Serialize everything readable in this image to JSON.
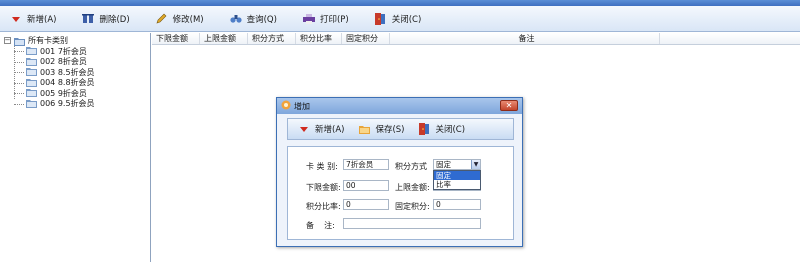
{
  "toolbar": {
    "add": "新增(A)",
    "delete": "删除(D)",
    "modify": "修改(M)",
    "query": "查询(Q)",
    "print": "打印(P)",
    "close": "关闭(C)"
  },
  "tree": {
    "root": "所有卡类别",
    "items": [
      {
        "label": "001 7折会员"
      },
      {
        "label": "002 8折会员"
      },
      {
        "label": "003 8.5折会员"
      },
      {
        "label": "004 8.8折会员"
      },
      {
        "label": "005 9折会员"
      },
      {
        "label": "006 9.5折会员"
      }
    ]
  },
  "grid": {
    "columns": [
      "下限金额",
      "上限金额",
      "积分方式",
      "积分比率",
      "固定积分",
      "备注"
    ]
  },
  "dialog": {
    "title": "增加",
    "toolbar": {
      "add": "新增(A)",
      "save": "保存(S)",
      "close": "关闭(C)"
    },
    "fields": {
      "card_type_label": "卡 类 别:",
      "card_type_value": "7折会员",
      "points_method_label": "积分方式",
      "points_method_value": "固定",
      "lower_limit_label": "下限金额:",
      "lower_limit_value": "00",
      "upper_limit_label": "上限金额:",
      "upper_limit_value": "",
      "points_ratio_label": "积分比率:",
      "points_ratio_value": "0",
      "fixed_points_label": "固定积分:",
      "fixed_points_value": "0",
      "remark_label": "备    注:",
      "remark_value": ""
    },
    "dropdown_options": [
      "固定",
      "比率"
    ]
  }
}
